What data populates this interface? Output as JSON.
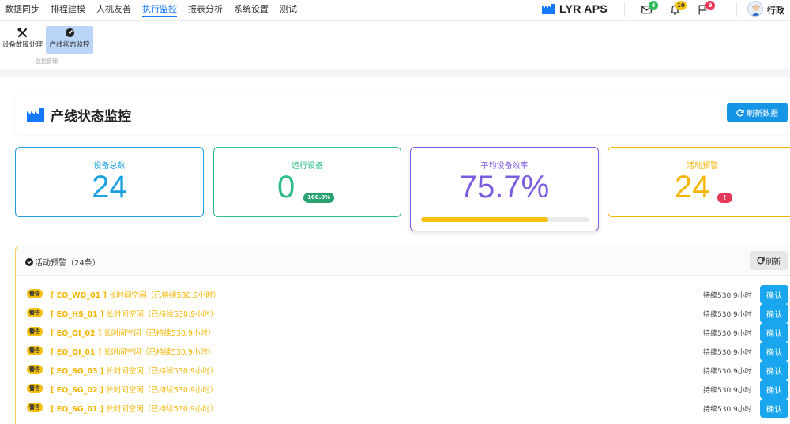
{
  "nav": {
    "menu": [
      "数据同步",
      "排程建模",
      "人机友善",
      "执行监控",
      "报表分析",
      "系统设置",
      "测试"
    ],
    "active_index": 3,
    "brand": "LYR APS",
    "badges": {
      "mail": "4",
      "bell": "10",
      "flag": "9"
    },
    "user_name": "行政"
  },
  "ribbon": {
    "buttons": [
      "设备故障处理",
      "产线状态监控"
    ],
    "group_label": "监控管理"
  },
  "header": {
    "title": "产线状态监控",
    "refresh_label": "刷新数据"
  },
  "stats": {
    "total": {
      "label": "设备总数",
      "value": "24"
    },
    "running": {
      "label": "运行设备",
      "value": "0",
      "badge": "100.0%"
    },
    "efficiency": {
      "label": "平均设备效率",
      "value": "75.7%",
      "progress": 0.757
    },
    "alerts": {
      "label": "活动预警",
      "value": "24",
      "badge": "!"
    }
  },
  "alerts_panel": {
    "title": "活动预警（24条）",
    "refresh_label": "刷新",
    "badge_label": "警告",
    "confirm_label": "确认",
    "rows": [
      {
        "equip": "[ EQ_WD_01 ]",
        "message": "长时间空闲（已持续530.9小时）",
        "duration": "持续530.9小时"
      },
      {
        "equip": "[ EQ_HS_01 ]",
        "message": "长时间空闲（已持续530.9小时）",
        "duration": "持续530.9小时"
      },
      {
        "equip": "[ EQ_QI_02 ]",
        "message": "长时间空闲（已持续530.9小时）",
        "duration": "持续530.9小时"
      },
      {
        "equip": "[ EQ_QI_01 ]",
        "message": "长时间空闲（已持续530.9小时）",
        "duration": "持续530.9小时"
      },
      {
        "equip": "[ EQ_SG_03 ]",
        "message": "长时间空闲（已持续530.9小时）",
        "duration": "持续530.9小时"
      },
      {
        "equip": "[ EQ_SG_02 ]",
        "message": "长时间空闲（已持续530.9小时）",
        "duration": "持续530.9小时"
      },
      {
        "equip": "[ EQ_SG_01 ]",
        "message": "长时间空闲（已持续530.9小时）",
        "duration": "持续530.9小时"
      }
    ]
  },
  "colors": {
    "accent": "#1677ff",
    "total": "#1aa0e0",
    "running": "#2ebd86",
    "efficiency": "#7b5ce0",
    "alerts": "#f5b400",
    "danger": "#e8385a"
  }
}
